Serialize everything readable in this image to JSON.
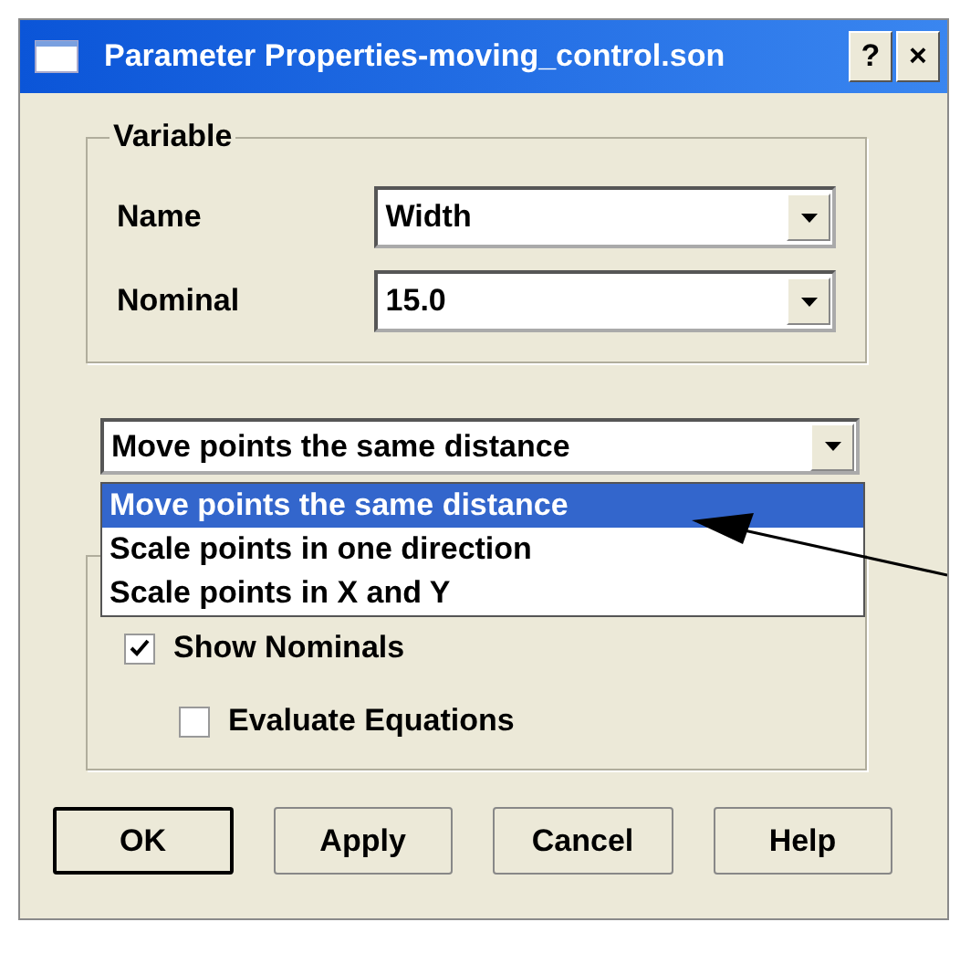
{
  "window": {
    "title": "Parameter Properties-moving_control.son",
    "help_button": "?",
    "close_button": "×"
  },
  "variable_group": {
    "title": "Variable",
    "fields": [
      {
        "label": "Name",
        "value": "Width"
      },
      {
        "label": "Nominal",
        "value": "15.0"
      }
    ]
  },
  "mode_combo": {
    "value": "Move points the same distance",
    "open": true,
    "options": [
      {
        "label": "Move points the same distance",
        "selected": true
      },
      {
        "label": "Scale points in one direction",
        "selected": false
      },
      {
        "label": "Scale points in X and Y",
        "selected": false
      }
    ]
  },
  "options_group": {
    "checkboxes": [
      {
        "label": "Show Nominals",
        "checked": true,
        "children": [
          {
            "label": "Evaluate Equations",
            "checked": false
          }
        ]
      }
    ]
  },
  "buttons": [
    {
      "label": "OK",
      "default": true
    },
    {
      "label": "Apply",
      "default": false
    },
    {
      "label": "Cancel",
      "default": false
    },
    {
      "label": "Help",
      "default": false
    }
  ]
}
